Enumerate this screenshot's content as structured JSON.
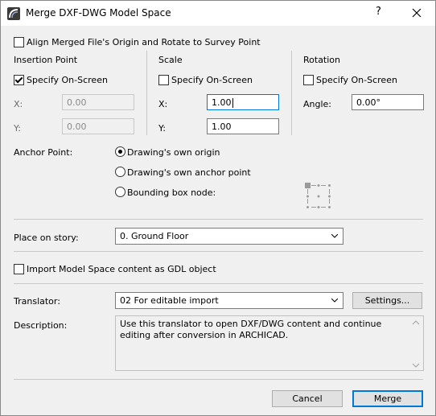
{
  "window": {
    "title": "Merge DXF-DWG Model Space",
    "help_label": "?"
  },
  "align": {
    "label": "Align Merged File's Origin and Rotate to Survey Point",
    "checked": false
  },
  "insertion": {
    "title": "Insertion Point",
    "specify_label": "Specify On-Screen",
    "specify_checked": true,
    "x_label": "X:",
    "x_value": "0.00",
    "y_label": "Y:",
    "y_value": "0.00"
  },
  "scale": {
    "title": "Scale",
    "specify_label": "Specify On-Screen",
    "specify_checked": false,
    "x_label": "X:",
    "x_value": "1.00",
    "y_label": "Y:",
    "y_value": "1.00"
  },
  "rotation": {
    "title": "Rotation",
    "specify_label": "Specify On-Screen",
    "specify_checked": false,
    "angle_label": "Angle:",
    "angle_value": "0.00°"
  },
  "anchor": {
    "label": "Anchor Point:",
    "options": [
      "Drawing's own origin",
      "Drawing's own anchor point",
      "Bounding box node:"
    ],
    "selected_index": 0,
    "node_icon": "bounding-box-node-grid-icon"
  },
  "story": {
    "label": "Place on story:",
    "value": "0. Ground Floor"
  },
  "gdl": {
    "label": "Import Model Space content as GDL object",
    "checked": false
  },
  "translator": {
    "label": "Translator:",
    "value": "02 For editable import",
    "settings_label": "Settings..."
  },
  "description": {
    "label": "Description:",
    "text": "Use this translator to open DXF/DWG content and continue editing after conversion in ARCHICAD."
  },
  "buttons": {
    "cancel": "Cancel",
    "merge": "Merge"
  },
  "colors": {
    "accent": "#0078d7",
    "window_bg": "#f0f0f0"
  }
}
